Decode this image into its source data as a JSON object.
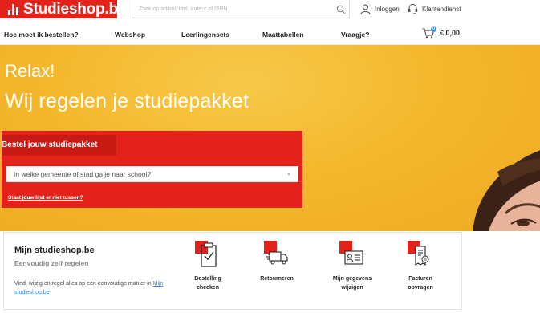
{
  "header": {
    "logo_text": "Studieshop.be",
    "search_placeholder": "Zoek op artikel, titel, auteur of ISBN",
    "login_label": "Inloggen",
    "service_label": "Klantendienst"
  },
  "nav": {
    "items": [
      "Hoe moet ik bestellen?",
      "Webshop",
      "Leerlingensets",
      "Maattabellen",
      "Vraagje?"
    ],
    "cart_count": "0",
    "cart_amount": "€ 0,00"
  },
  "hero": {
    "title_line1": "Relax!",
    "title_line2": "Wij regelen je studiepakket"
  },
  "order": {
    "tab_label": "Bestel jouw studiepakket",
    "select_placeholder": "In welke gemeente of stad ga je naar school?",
    "link_label": "Staat jouw lijst er niet tussen?"
  },
  "card": {
    "title": "Mijn studieshop.be",
    "subtitle": "Eenvoudig zelf regelen",
    "text": "Vind, wijzig en regel alles op een eenvoudige manier in",
    "link": "Mijn studieshop.be",
    "features": [
      {
        "label": "Bestelling checken",
        "icon": "clipboard-check-icon"
      },
      {
        "label": "Retourneren",
        "icon": "truck-return-icon"
      },
      {
        "label": "Mijn gegevens wijzigen",
        "icon": "id-card-icon"
      },
      {
        "label": "Facturen opvragen",
        "icon": "invoice-icon"
      }
    ]
  },
  "colors": {
    "brand_red": "#e3231b",
    "hero_yellow": "#f4b82d",
    "badge_blue": "#3c93d8"
  }
}
